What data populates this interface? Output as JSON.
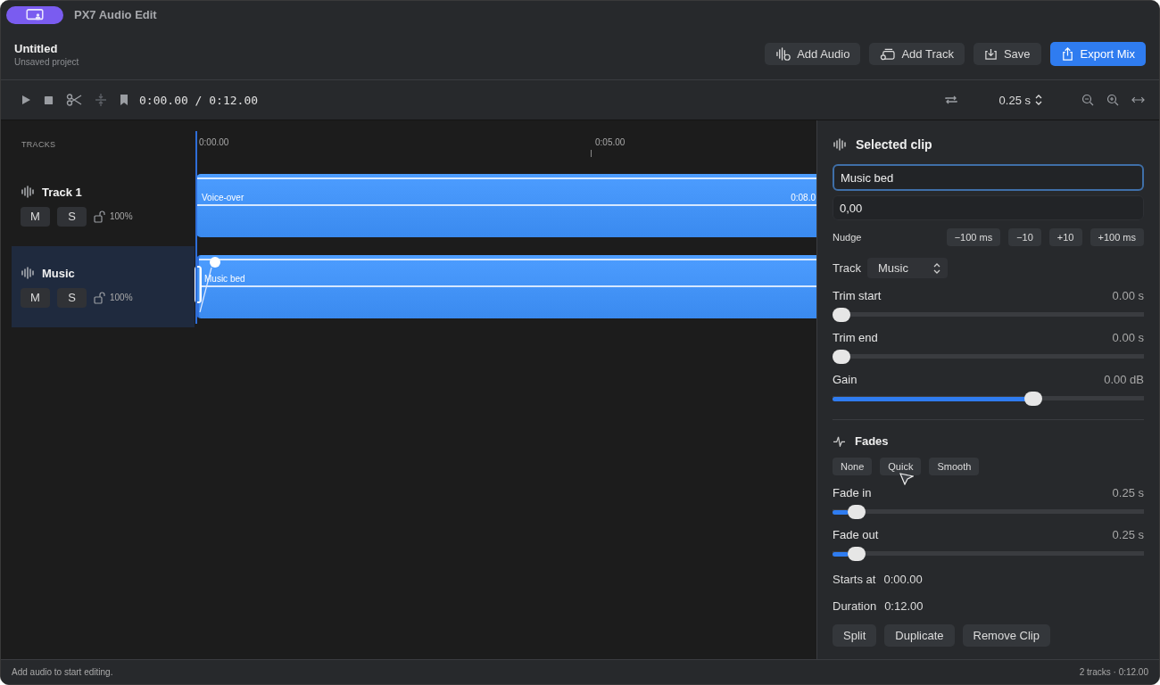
{
  "window": {
    "title": "PX7 Audio Edit"
  },
  "project": {
    "title": "Untitled",
    "subtitle": "Unsaved project"
  },
  "header_buttons": [
    {
      "label": "Add Audio",
      "kind": "audio",
      "primary": false
    },
    {
      "label": "Add Track",
      "kind": "track",
      "primary": false
    },
    {
      "label": "Save",
      "kind": "save",
      "primary": false
    },
    {
      "label": "Export Mix",
      "kind": "export",
      "primary": true
    }
  ],
  "transport": {
    "time": "0:00.00 / 0:12.00",
    "snap": "0.25 s"
  },
  "tracks_header": "TRACKS",
  "ruler": [
    "0:00.00",
    "0:05.00"
  ],
  "tracks": [
    {
      "name": "Track 1",
      "selected": false,
      "muted": false,
      "solo": false,
      "mute_label": "M",
      "solo_label": "S",
      "volume": "100%",
      "clip": {
        "label": "Voice-over",
        "end_label": "0:08.0",
        "selected": false
      }
    },
    {
      "name": "Music",
      "selected": true,
      "muted": false,
      "solo": false,
      "mute_label": "M",
      "solo_label": "S",
      "volume": "100%",
      "clip": {
        "label": "Music bed",
        "selected": true
      }
    }
  ],
  "inspector": {
    "title": "Selected clip",
    "name_value": "Music bed",
    "offset_value": "0,00",
    "nudge_label": "Nudge",
    "nudges": [
      "−100 ms",
      "−10",
      "+10",
      "+100 ms"
    ],
    "track_label": "Track",
    "track_value": "Music",
    "sliders": [
      {
        "label": "Trim start",
        "reading": "0.00 s",
        "level": 0
      },
      {
        "label": "Trim end",
        "reading": "0.00 s",
        "level": 0
      },
      {
        "label": "Gain",
        "reading": "0.00 dB",
        "level": 0.655
      }
    ],
    "fades_title": "Fades",
    "fade_modes": [
      {
        "label": "None",
        "selected": false
      },
      {
        "label": "Quick",
        "selected": false
      },
      {
        "label": "Smooth",
        "selected": false
      }
    ],
    "fade_sliders": [
      {
        "label": "Fade in",
        "reading": "0.25 s",
        "level": 0.053
      },
      {
        "label": "Fade out",
        "reading": "0.25 s",
        "level": 0.053
      }
    ],
    "info": [
      {
        "label": "Starts at",
        "value": "0:00.00"
      },
      {
        "label": "Duration",
        "value": "0:12.00"
      }
    ],
    "actions": [
      "Split",
      "Duplicate",
      "Remove Clip"
    ]
  },
  "status_bar": {
    "left": "Add audio to start editing.",
    "right": "2 tracks · 0:12.00"
  }
}
